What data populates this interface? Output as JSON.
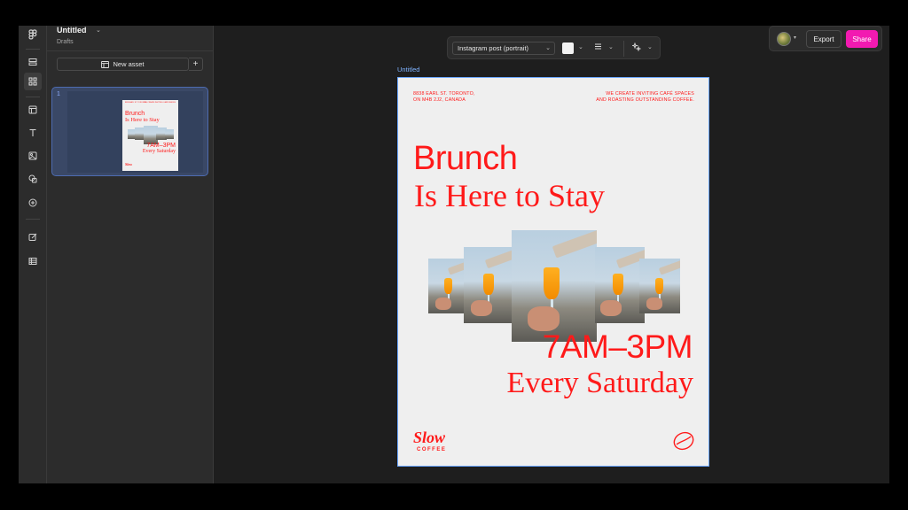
{
  "file": {
    "title": "Untitled",
    "location": "Drafts"
  },
  "panel": {
    "new_asset_label": "New asset",
    "add_label": "+",
    "pages": [
      {
        "number": "1"
      }
    ]
  },
  "toolbar": {
    "format": "Instagram post (portrait)",
    "swatch_color": "#f2f2f2"
  },
  "actions": {
    "export_label": "Export",
    "share_label": "Share",
    "share_color": "#f21ab1"
  },
  "canvas": {
    "frame_label": "Untitled",
    "poster": {
      "address_line1": "8838 EARL ST. TORONTO,",
      "address_line2": "ON M4B 2J2, CANADA",
      "tagline_line1": "WE CREATE INVITING CAFÉ SPACES",
      "tagline_line2": "AND ROASTING OUTSTANDING COFFEE.",
      "headline_line1": "Brunch",
      "headline_line2": "Is Here to Stay",
      "hours": "7AM–3PM",
      "day": "Every Saturday",
      "brand_name": "Slow",
      "brand_sub": "COFFEE",
      "accent_color": "#ff1a1a"
    }
  },
  "icons": {
    "rail": [
      "figma-menu-icon",
      "layout-icon",
      "assets-grid-icon",
      "frame-icon",
      "text-icon",
      "image-icon",
      "shapes-icon",
      "plugins-icon",
      "edit-icon",
      "table-icon"
    ]
  }
}
